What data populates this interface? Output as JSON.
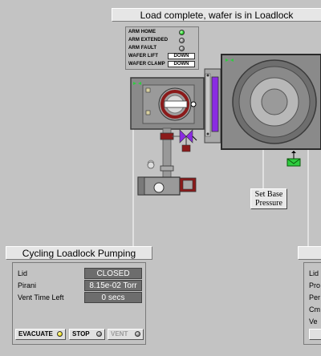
{
  "status": {
    "message": "Load complete, wafer is in Loadlock"
  },
  "arm_status": {
    "rows": [
      {
        "label": "ARM HOME",
        "indicator": "on"
      },
      {
        "label": "ARM EXTENDED",
        "indicator": "off"
      },
      {
        "label": "ARM FAULT",
        "indicator": "off"
      },
      {
        "label": "WAFER LIFT",
        "state": "DOWN"
      },
      {
        "label": "WAFER CLAMP",
        "state": "DOWN"
      }
    ]
  },
  "set_base_pressure": {
    "line1": "Set Base",
    "line2": "Pressure"
  },
  "loadlock_panel": {
    "title": "Cycling Loadlock Pumping",
    "lid_label": "Lid",
    "lid_value": "CLOSED",
    "pirani_label": "Pirani",
    "pirani_value": "8.15e-02 Torr",
    "vent_label": "Vent Time Left",
    "vent_value": "0 secs",
    "buttons": {
      "evacuate": "EVACUATE",
      "stop": "STOP",
      "vent": "VENT"
    }
  },
  "right_panel": {
    "labels": [
      "Lid",
      "Pro",
      "Per",
      "Cm",
      "Ve"
    ]
  },
  "colors": {
    "background": "#c3c3c3",
    "led_green": "#27d327",
    "purple_window": "#8a2be2",
    "valve_red": "#8b1a1a",
    "chamber_gray": "#8a8a8a"
  },
  "icons": [
    "green-arrow-icon",
    "purple-valve-icon",
    "green-envelope-icon",
    "vacuum-pump-icon",
    "gear-icon"
  ]
}
